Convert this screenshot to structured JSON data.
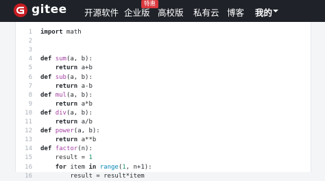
{
  "header": {
    "brand": "gitee",
    "nav": [
      "开源软件",
      "企业版",
      "高校版",
      "私有云",
      "博客",
      "我的"
    ],
    "badge": "特惠",
    "colors": {
      "bar": "#1f2329",
      "logo": "#c71d23",
      "badge": "#d9383e"
    }
  },
  "code": {
    "lines": [
      {
        "n": "1",
        "t": "import math"
      },
      {
        "n": "2",
        "t": ""
      },
      {
        "n": "3",
        "t": ""
      },
      {
        "n": "4",
        "t": "def sum(a, b):"
      },
      {
        "n": "5",
        "t": "    return a+b"
      },
      {
        "n": "6",
        "t": "def sub(a, b):"
      },
      {
        "n": "7",
        "t": "    return a-b"
      },
      {
        "n": "8",
        "t": "def mul(a, b):"
      },
      {
        "n": "9",
        "t": "    return a*b"
      },
      {
        "n": "10",
        "t": "def div(a, b):"
      },
      {
        "n": "11",
        "t": "    return a/b"
      },
      {
        "n": "12",
        "t": "def power(a, b):"
      },
      {
        "n": "13",
        "t": "    return a**b"
      },
      {
        "n": "14",
        "t": "def factor(n):"
      },
      {
        "n": "15",
        "t": "    result = 1"
      },
      {
        "n": "16",
        "t": "    for item in range(1, n+1):"
      },
      {
        "n": "16",
        "t": "        result = result*item"
      }
    ]
  }
}
